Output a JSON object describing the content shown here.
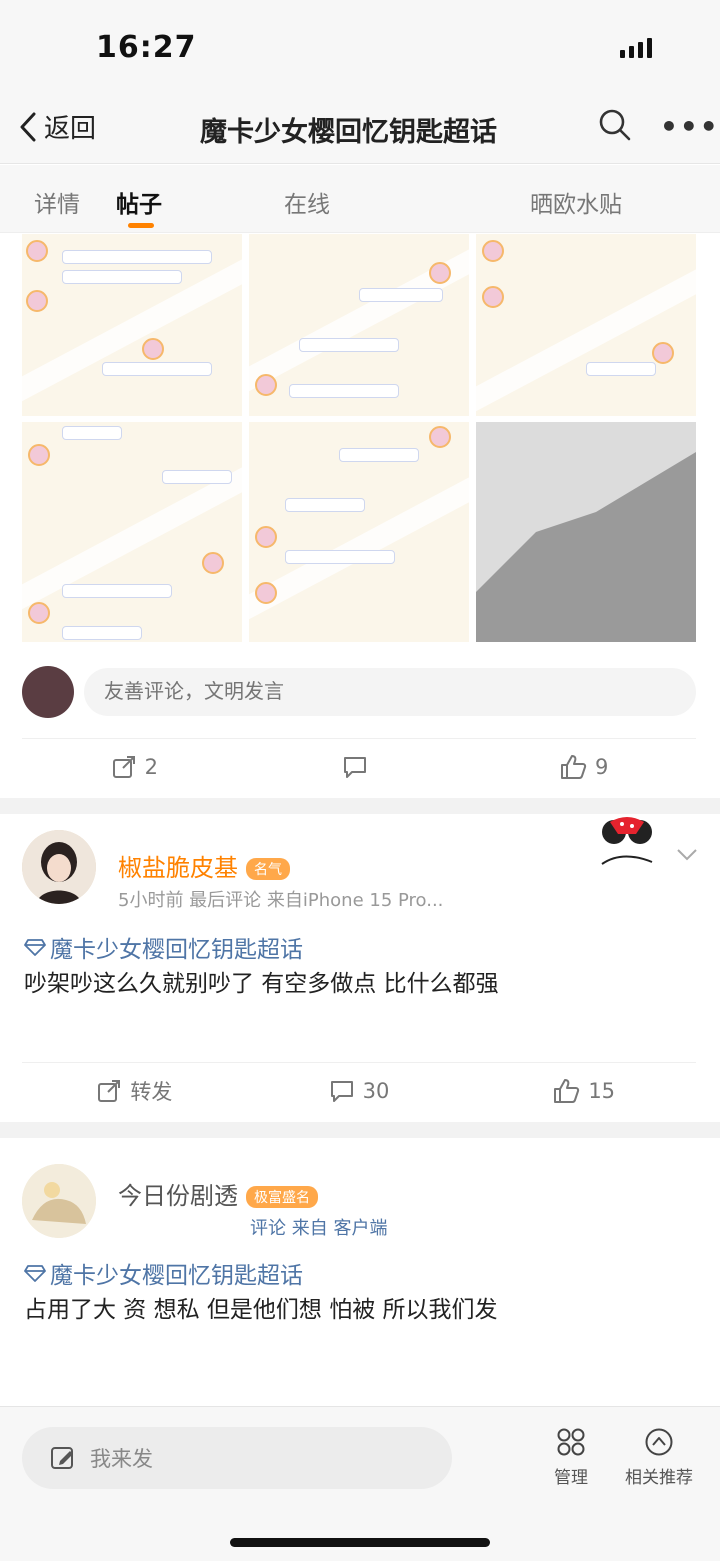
{
  "status_bar": {
    "time": "16:27"
  },
  "nav": {
    "back_label": "返回",
    "title": "魔卡少女樱回忆钥匙超话",
    "more_label": "•••"
  },
  "tabs": [
    {
      "label": "详情",
      "active": false
    },
    {
      "label": "帖子",
      "active": true
    },
    {
      "label": "",
      "active": false
    },
    {
      "label": "在线",
      "active": false
    },
    {
      "label": "",
      "active": false
    },
    {
      "label": "晒欧水贴",
      "active": false
    }
  ],
  "post1": {
    "comment_placeholder": "友善评论，文明发言",
    "actions": {
      "share_count": "2",
      "comment_count": "",
      "like_count": "9"
    }
  },
  "post2": {
    "author": "椒盐脆皮基",
    "badge": "名气",
    "meta": "5小时前 最后评论 来自iPhone 15 Pro...",
    "topic": "魔卡少女樱回忆钥匙超话",
    "body": "吵架吵这么久就别吵了 有空多做点 比什么都强",
    "actions": {
      "share_label": "转发",
      "comment_count": "30",
      "like_count": "15"
    }
  },
  "post3": {
    "author": "今日份剧透",
    "badge": "极富盛名",
    "meta": "评论 来自 客户端",
    "topic": "魔卡少女樱回忆钥匙超话",
    "body": "占用了大 资 想私 但是他们想 怕被 所以我们发"
  },
  "bottom_bar": {
    "publish_placeholder": "我来发",
    "manage_label": "管理",
    "related_label": "相关推荐"
  },
  "colors": {
    "accent": "#ff8200",
    "topic": "#4f75a6",
    "meta": "#999999"
  }
}
